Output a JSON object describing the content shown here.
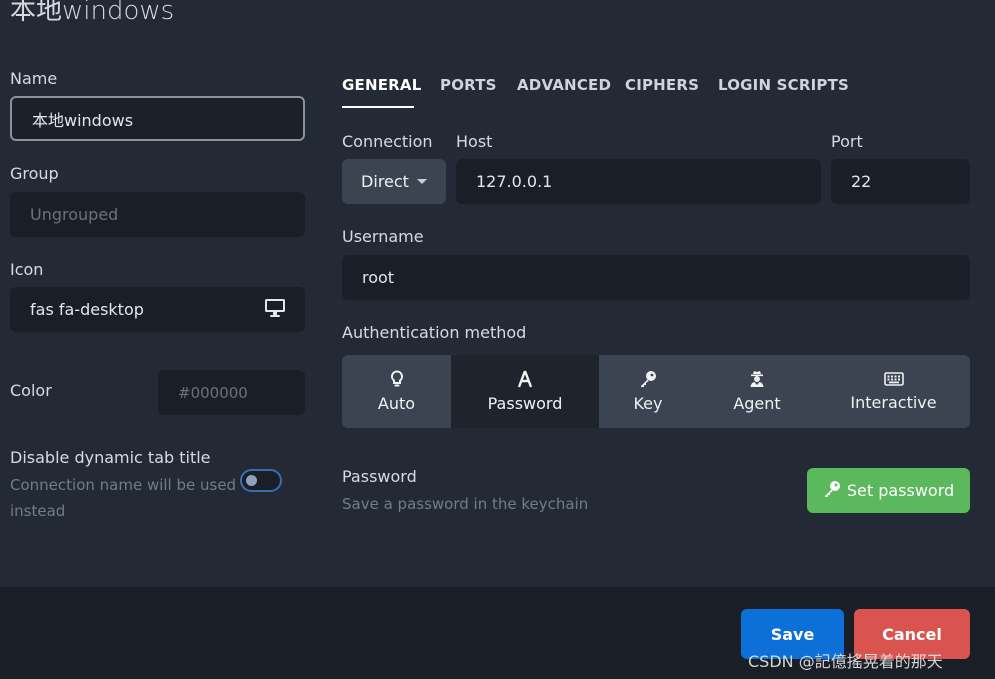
{
  "dialog": {
    "title": "本地windows"
  },
  "left": {
    "name_label": "Name",
    "name_value": "本地windows",
    "group_label": "Group",
    "group_placeholder": "Ungrouped",
    "icon_label": "Icon",
    "icon_value": "fas fa-desktop",
    "icon_preview": "desktop-icon",
    "color_label": "Color",
    "color_placeholder": "#000000",
    "dynamic_title_label": "Disable dynamic tab title",
    "dynamic_title_desc_line1": "Connection name will be used",
    "dynamic_title_desc_line2": "instead",
    "dynamic_title_enabled": false
  },
  "tabs": [
    {
      "label": "GENERAL",
      "active": true
    },
    {
      "label": "PORTS",
      "active": false
    },
    {
      "label": "ADVANCED",
      "active": false
    },
    {
      "label": "CIPHERS",
      "active": false
    },
    {
      "label": "LOGIN SCRIPTS",
      "active": false
    }
  ],
  "general": {
    "connection_label": "Connection",
    "connection_value": "Direct",
    "host_label": "Host",
    "host_value": "127.0.0.1",
    "port_label": "Port",
    "port_value": "22",
    "username_label": "Username",
    "username_value": "root",
    "auth_label": "Authentication method",
    "auth_methods": [
      {
        "label": "Auto",
        "icon": "lightbulb-icon",
        "active": false
      },
      {
        "label": "Password",
        "icon": "font-icon",
        "active": true
      },
      {
        "label": "Key",
        "icon": "key-icon",
        "active": false
      },
      {
        "label": "Agent",
        "icon": "user-secret-icon",
        "active": false
      },
      {
        "label": "Interactive",
        "icon": "keyboard-icon",
        "active": false
      }
    ],
    "password_label": "Password",
    "password_desc": "Save a password in the keychain",
    "set_password_label": "Set password"
  },
  "footer": {
    "save_label": "Save",
    "cancel_label": "Cancel"
  },
  "colors": {
    "save": "#0d6fd8",
    "cancel": "#d9534f",
    "set_password": "#5cb85c",
    "background": "#232a35"
  },
  "watermark": "CSDN @記億搖晃着的那天"
}
